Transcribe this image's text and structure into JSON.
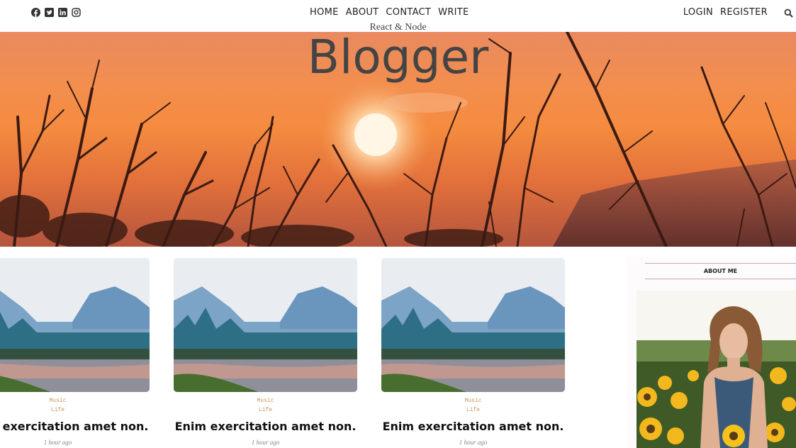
{
  "nav": {
    "social_icons": [
      "facebook-icon",
      "twitter-icon",
      "linkedin-icon",
      "instagram-icon"
    ],
    "links": [
      "HOME",
      "ABOUT",
      "CONTACT",
      "WRITE"
    ],
    "auth": {
      "login": "LOGIN",
      "register": "REGISTER"
    },
    "search_icon": "search-icon"
  },
  "header": {
    "subtitle": "React & Node",
    "title": "Blogger"
  },
  "posts": [
    {
      "categories": [
        "Music",
        "Life"
      ],
      "title": "Enim exercitation amet non.",
      "date": "1 hour ago"
    },
    {
      "categories": [
        "Music",
        "Life"
      ],
      "title": "Enim exercitation amet non.",
      "date": "1 hour ago"
    },
    {
      "categories": [
        "Music",
        "Life"
      ],
      "title": "Enim exercitation amet non.",
      "date": "1 hour ago"
    }
  ],
  "sidebar": {
    "about_title": "ABOUT ME"
  },
  "colors": {
    "accent": "#c5995c",
    "divider": "#c6a9a4"
  }
}
